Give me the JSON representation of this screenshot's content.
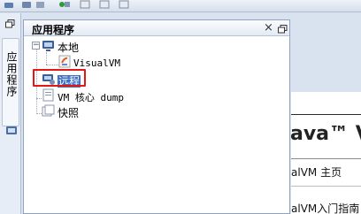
{
  "panel": {
    "title": "应用程序",
    "close_glyph": "×"
  },
  "dock": {
    "tab_label": "应用程序"
  },
  "tree": {
    "local": {
      "label": "本地",
      "icon": "computer-icon"
    },
    "visualvm": {
      "label": "VisualVM",
      "icon": "java-app-icon"
    },
    "remote": {
      "label": "远程",
      "icon": "remote-host-icon",
      "selected": true
    },
    "core_dump": {
      "label": "VM 核心 dump",
      "icon": "core-dump-icon"
    },
    "snapshots": {
      "label": "快照",
      "icon": "snapshots-icon"
    }
  },
  "start_page": {
    "java_heading": "ava™ V",
    "link_home": "alVM 主页",
    "link_guide": "alVM入门指南"
  },
  "colors": {
    "selection": "#3d6fc8",
    "highlight_border": "#e41616",
    "panel_border": "#8ea3c2"
  }
}
